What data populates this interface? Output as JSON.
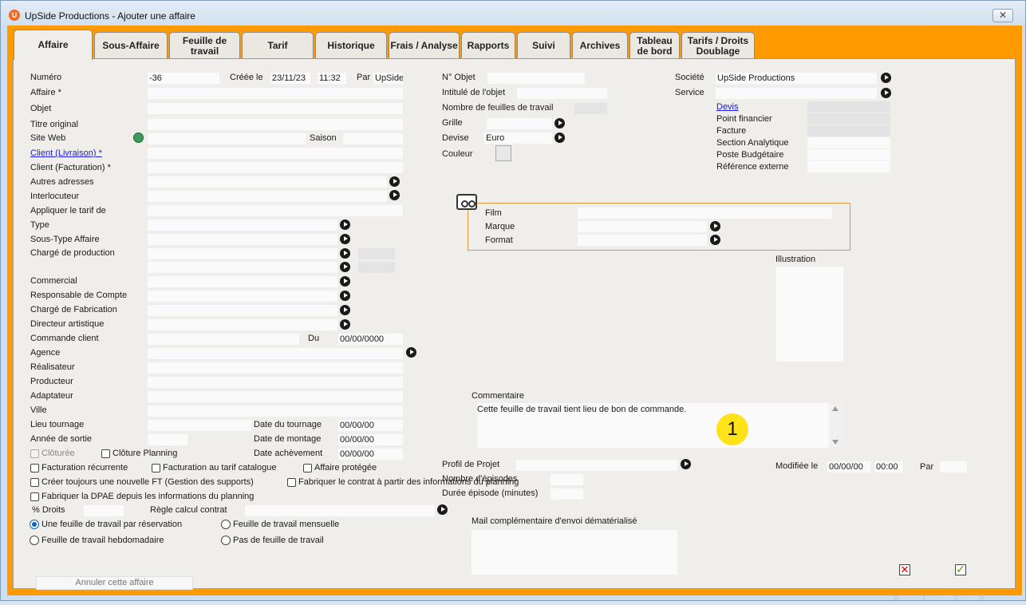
{
  "window": {
    "title": "UpSide Productions - Ajouter une affaire",
    "close": "✕"
  },
  "tabs": [
    "Affaire",
    "Sous-Affaire",
    "Feuille de travail",
    "Tarif",
    "Historique",
    "Frais / Analyse",
    "Rapports",
    "Suivi",
    "Archives",
    "Tableau de bord",
    "Tarifs / Droits Doublage"
  ],
  "col1": {
    "numero_label": "Numéro",
    "numero": "-36",
    "creee_label": "Créée le",
    "date": "23/11/23",
    "time": "11:32",
    "par_label": "Par",
    "par": "UpSide",
    "affaire": "Affaire *",
    "objet": "Objet",
    "titre": "Titre original",
    "site": "Site Web",
    "saison": "Saison",
    "client_liv": "Client (Livraison) *",
    "client_fac": "Client (Facturation) *",
    "autres": "Autres adresses",
    "interlocuteur": "Interlocuteur",
    "appliquer": "Appliquer le tarif de",
    "type": "Type",
    "soustype": "Sous-Type Affaire",
    "charge_prod": "Chargé de production",
    "commercial": "Commercial",
    "resp": "Responsable de Compte",
    "charge_fab": "Chargé de Fabrication",
    "directeur": "Directeur artistique",
    "commande": "Commande client",
    "du": "Du",
    "du_val": "00/00/0000",
    "agence": "Agence",
    "realisateur": "Réalisateur",
    "producteur": "Producteur",
    "adaptateur": "Adaptateur",
    "ville": "Ville",
    "lieu": "Lieu tournage",
    "date_tournage": "Date du tournage",
    "annee": "Année de sortie",
    "date_montage": "Date de montage",
    "date_achev": "Date achèvement",
    "zero_date": "00/00/00"
  },
  "checks": {
    "cloturee": "Clôturée",
    "cloture_planning": "Clôture Planning",
    "fact_rec": "Facturation récurrente",
    "fact_tarif": "Facturation au tarif catalogue",
    "protegee": "Affaire protégée",
    "creer_ft": "Créer toujours une nouvelle FT (Gestion des supports)",
    "fab_contrat": "Fabriquer le contrat à partir des informations du planning",
    "fab_dpae": "Fabriquer la DPAE depuis les informations du planning",
    "droits": "% Droits",
    "regle": "Règle calcul contrat"
  },
  "radios": {
    "r1": "Une feuille de travail par réservation",
    "r2": "Feuille de travail mensuelle",
    "r3": "Feuille de travail hebdomadaire",
    "r4": "Pas de feuille de travail"
  },
  "cancel_btn": "Annuler cette affaire",
  "col2": {
    "n_objet": "N° Objet",
    "intitule": "Intitulé de l'objet",
    "nb_feuilles": "Nombre de feuilles de travail",
    "grille": "Grille",
    "devise": "Devise",
    "devise_val": "Euro",
    "couleur": "Couleur",
    "film": "Film",
    "marque": "Marque",
    "format": "Format",
    "commentaire": "Commentaire",
    "comment_text": "Cette feuille de travail tient lieu de bon de commande.",
    "profil": "Profil de Projet",
    "nb_episodes": "Nombre d'épisodes",
    "duree": "Durée épisode (minutes)",
    "mail": "Mail complémentaire d'envoi dématérialisé"
  },
  "col3": {
    "societe": "Société",
    "societe_val": "UpSide Productions",
    "service": "Service",
    "devis": "Devis",
    "point": "Point financier",
    "facture": "Facture",
    "section": "Section Analytique",
    "poste": "Poste Budgétaire",
    "ref": "Référence externe",
    "illustration": "Illustration",
    "modifiee": "Modifiée le",
    "mod_date": "00/00/00",
    "mod_time": "00:00",
    "par": "Par"
  },
  "badge": "1"
}
